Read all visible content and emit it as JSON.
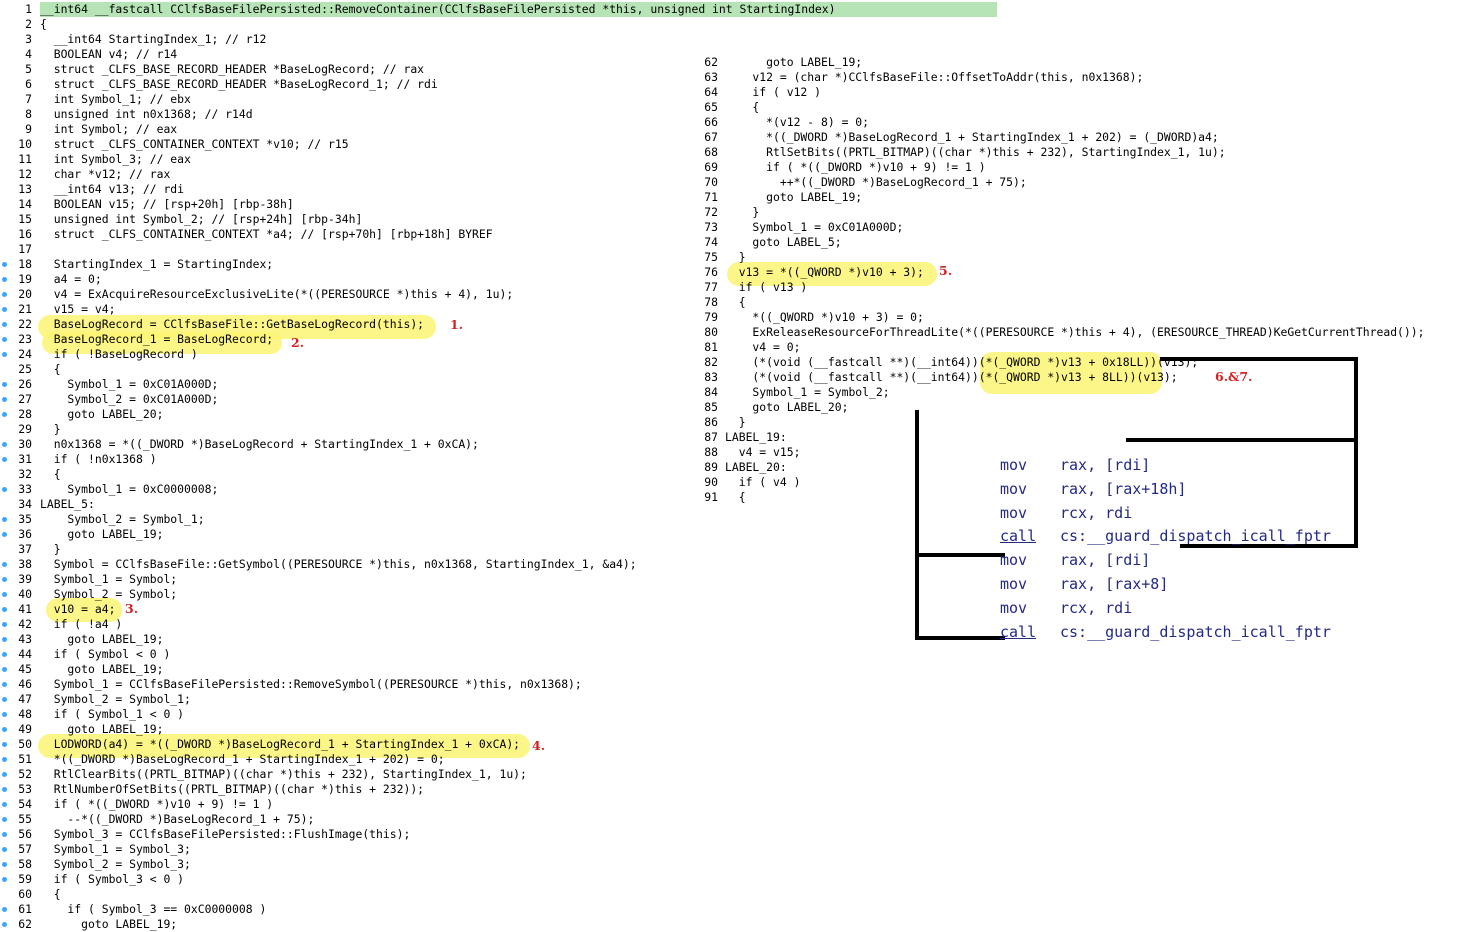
{
  "left_lines": [
    {
      "n": "1",
      "dot": false,
      "text": "__int64 __fastcall CClfsBaseFilePersisted::RemoveContainer(CClfsBaseFilePersisted *this, unsigned int StartingIndex)"
    },
    {
      "n": "2",
      "dot": false,
      "text": "{"
    },
    {
      "n": "3",
      "dot": false,
      "text": "  __int64 StartingIndex_1; // r12"
    },
    {
      "n": "4",
      "dot": false,
      "text": "  BOOLEAN v4; // r14"
    },
    {
      "n": "5",
      "dot": false,
      "text": "  struct _CLFS_BASE_RECORD_HEADER *BaseLogRecord; // rax"
    },
    {
      "n": "6",
      "dot": false,
      "text": "  struct _CLFS_BASE_RECORD_HEADER *BaseLogRecord_1; // rdi"
    },
    {
      "n": "7",
      "dot": false,
      "text": "  int Symbol_1; // ebx"
    },
    {
      "n": "8",
      "dot": false,
      "text": "  unsigned int n0x1368; // r14d"
    },
    {
      "n": "9",
      "dot": false,
      "text": "  int Symbol; // eax"
    },
    {
      "n": "10",
      "dot": false,
      "text": "  struct _CLFS_CONTAINER_CONTEXT *v10; // r15"
    },
    {
      "n": "11",
      "dot": false,
      "text": "  int Symbol_3; // eax"
    },
    {
      "n": "12",
      "dot": false,
      "text": "  char *v12; // rax"
    },
    {
      "n": "13",
      "dot": false,
      "text": "  __int64 v13; // rdi"
    },
    {
      "n": "14",
      "dot": false,
      "text": "  BOOLEAN v15; // [rsp+20h] [rbp-38h]"
    },
    {
      "n": "15",
      "dot": false,
      "text": "  unsigned int Symbol_2; // [rsp+24h] [rbp-34h]"
    },
    {
      "n": "16",
      "dot": false,
      "text": "  struct _CLFS_CONTAINER_CONTEXT *a4; // [rsp+70h] [rbp+18h] BYREF"
    },
    {
      "n": "17",
      "dot": false,
      "text": ""
    },
    {
      "n": "18",
      "dot": true,
      "text": "  StartingIndex_1 = StartingIndex;"
    },
    {
      "n": "19",
      "dot": true,
      "text": "  a4 = 0;"
    },
    {
      "n": "20",
      "dot": true,
      "text": "  v4 = ExAcquireResourceExclusiveLite(*((PERESOURCE *)this + 4), 1u);"
    },
    {
      "n": "21",
      "dot": true,
      "text": "  v15 = v4;"
    },
    {
      "n": "22",
      "dot": true,
      "text": "  BaseLogRecord = CClfsBaseFile::GetBaseLogRecord(this);"
    },
    {
      "n": "23",
      "dot": true,
      "text": "  BaseLogRecord_1 = BaseLogRecord;"
    },
    {
      "n": "24",
      "dot": true,
      "text": "  if ( !BaseLogRecord )"
    },
    {
      "n": "25",
      "dot": false,
      "text": "  {"
    },
    {
      "n": "26",
      "dot": true,
      "text": "    Symbol_1 = 0xC01A000D;"
    },
    {
      "n": "27",
      "dot": true,
      "text": "    Symbol_2 = 0xC01A000D;"
    },
    {
      "n": "28",
      "dot": true,
      "text": "    goto LABEL_20;"
    },
    {
      "n": "29",
      "dot": false,
      "text": "  }"
    },
    {
      "n": "30",
      "dot": true,
      "text": "  n0x1368 = *((_DWORD *)BaseLogRecord + StartingIndex_1 + 0xCA);"
    },
    {
      "n": "31",
      "dot": true,
      "text": "  if ( !n0x1368 )"
    },
    {
      "n": "32",
      "dot": false,
      "text": "  {"
    },
    {
      "n": "33",
      "dot": true,
      "text": "    Symbol_1 = 0xC0000008;"
    },
    {
      "n": "34",
      "dot": false,
      "text": "LABEL_5:"
    },
    {
      "n": "35",
      "dot": true,
      "text": "    Symbol_2 = Symbol_1;"
    },
    {
      "n": "36",
      "dot": true,
      "text": "    goto LABEL_19;"
    },
    {
      "n": "37",
      "dot": false,
      "text": "  }"
    },
    {
      "n": "38",
      "dot": true,
      "text": "  Symbol = CClfsBaseFile::GetSymbol((PERESOURCE *)this, n0x1368, StartingIndex_1, &a4);"
    },
    {
      "n": "39",
      "dot": true,
      "text": "  Symbol_1 = Symbol;"
    },
    {
      "n": "40",
      "dot": true,
      "text": "  Symbol_2 = Symbol;"
    },
    {
      "n": "41",
      "dot": true,
      "text": "  v10 = a4;"
    },
    {
      "n": "42",
      "dot": true,
      "text": "  if ( !a4 )"
    },
    {
      "n": "43",
      "dot": true,
      "text": "    goto LABEL_19;"
    },
    {
      "n": "44",
      "dot": true,
      "text": "  if ( Symbol < 0 )"
    },
    {
      "n": "45",
      "dot": true,
      "text": "    goto LABEL_19;"
    },
    {
      "n": "46",
      "dot": true,
      "text": "  Symbol_1 = CClfsBaseFilePersisted::RemoveSymbol((PERESOURCE *)this, n0x1368);"
    },
    {
      "n": "47",
      "dot": true,
      "text": "  Symbol_2 = Symbol_1;"
    },
    {
      "n": "48",
      "dot": true,
      "text": "  if ( Symbol_1 < 0 )"
    },
    {
      "n": "49",
      "dot": true,
      "text": "    goto LABEL_19;"
    },
    {
      "n": "50",
      "dot": true,
      "text": "  LODWORD(a4) = *((_DWORD *)BaseLogRecord_1 + StartingIndex_1 + 0xCA);"
    },
    {
      "n": "51",
      "dot": true,
      "text": "  *((_DWORD *)BaseLogRecord_1 + StartingIndex_1 + 202) = 0;"
    },
    {
      "n": "52",
      "dot": true,
      "text": "  RtlClearBits((PRTL_BITMAP)((char *)this + 232), StartingIndex_1, 1u);"
    },
    {
      "n": "53",
      "dot": true,
      "text": "  RtlNumberOfSetBits((PRTL_BITMAP)((char *)this + 232));"
    },
    {
      "n": "54",
      "dot": true,
      "text": "  if ( *((_DWORD *)v10 + 9) != 1 )"
    },
    {
      "n": "55",
      "dot": true,
      "text": "    --*((_DWORD *)BaseLogRecord_1 + 75);"
    },
    {
      "n": "56",
      "dot": true,
      "text": "  Symbol_3 = CClfsBaseFilePersisted::FlushImage(this);"
    },
    {
      "n": "57",
      "dot": true,
      "text": "  Symbol_1 = Symbol_3;"
    },
    {
      "n": "58",
      "dot": true,
      "text": "  Symbol_2 = Symbol_3;"
    },
    {
      "n": "59",
      "dot": true,
      "text": "  if ( Symbol_3 < 0 )"
    },
    {
      "n": "60",
      "dot": false,
      "text": "  {"
    },
    {
      "n": "61",
      "dot": true,
      "text": "    if ( Symbol_3 == 0xC0000008 )"
    },
    {
      "n": "62",
      "dot": true,
      "text": "      goto LABEL_19;"
    }
  ],
  "right_lines": [
    {
      "n": "62",
      "text": "      goto LABEL_19;"
    },
    {
      "n": "63",
      "text": "    v12 = (char *)CClfsBaseFile::OffsetToAddr(this, n0x1368);"
    },
    {
      "n": "64",
      "text": "    if ( v12 )"
    },
    {
      "n": "65",
      "text": "    {"
    },
    {
      "n": "66",
      "text": "      *(v12 - 8) = 0;"
    },
    {
      "n": "67",
      "text": "      *((_DWORD *)BaseLogRecord_1 + StartingIndex_1 + 202) = (_DWORD)a4;"
    },
    {
      "n": "68",
      "text": "      RtlSetBits((PRTL_BITMAP)((char *)this + 232), StartingIndex_1, 1u);"
    },
    {
      "n": "69",
      "text": "      if ( *((_DWORD *)v10 + 9) != 1 )"
    },
    {
      "n": "70",
      "text": "        ++*((_DWORD *)BaseLogRecord_1 + 75);"
    },
    {
      "n": "71",
      "text": "      goto LABEL_19;"
    },
    {
      "n": "72",
      "text": "    }"
    },
    {
      "n": "73",
      "text": "    Symbol_1 = 0xC01A000D;"
    },
    {
      "n": "74",
      "text": "    goto LABEL_5;"
    },
    {
      "n": "75",
      "text": "  }"
    },
    {
      "n": "76",
      "text": "  v13 = *((_QWORD *)v10 + 3);"
    },
    {
      "n": "77",
      "text": "  if ( v13 )"
    },
    {
      "n": "78",
      "text": "  {"
    },
    {
      "n": "79",
      "text": "    *((_QWORD *)v10 + 3) = 0;"
    },
    {
      "n": "80",
      "text": "    ExReleaseResourceForThreadLite(*((PERESOURCE *)this + 4), (ERESOURCE_THREAD)KeGetCurrentThread());"
    },
    {
      "n": "81",
      "text": "    v4 = 0;"
    },
    {
      "n": "82",
      "text": "    (*(void (__fastcall **)(__int64))(*(_QWORD *)v13 + 0x18LL))(v13);"
    },
    {
      "n": "83",
      "text": "    (*(void (__fastcall **)(__int64))(*(_QWORD *)v13 + 8LL))(v13);"
    },
    {
      "n": "84",
      "text": "    Symbol_1 = Symbol_2;"
    },
    {
      "n": "85",
      "text": "    goto LABEL_20;"
    },
    {
      "n": "86",
      "text": "  }"
    },
    {
      "n": "87",
      "text": "LABEL_19:"
    },
    {
      "n": "88",
      "text": "  v4 = v15;"
    },
    {
      "n": "89",
      "text": "LABEL_20:"
    },
    {
      "n": "90",
      "text": "  if ( v4 )"
    },
    {
      "n": "91",
      "text": "  {"
    }
  ],
  "markers": {
    "m1": "1.",
    "m2": "2.",
    "m3": "3.",
    "m4": "4.",
    "m5": "5.",
    "m67": "6.&7."
  },
  "asm": [
    {
      "op": "mov",
      "args": "rax, [rdi]"
    },
    {
      "op": "mov",
      "args": "rax, [rax+18h]"
    },
    {
      "op": "mov",
      "args": "rcx, rdi"
    },
    {
      "op": "call",
      "args": "cs:__guard_dispatch_icall_fptr"
    },
    {
      "op": "mov",
      "args": "rax, [rdi]"
    },
    {
      "op": "mov",
      "args": "rax, [rax+8]"
    },
    {
      "op": "mov",
      "args": "rcx, rdi"
    },
    {
      "op": "call",
      "args": "cs:__guard_dispatch_icall_fptr"
    }
  ],
  "colors": {
    "highlight": "#fbf473",
    "marker_red": "#d22222",
    "header_green": "#b7e4b6",
    "breakpoint_dot": "#3ea5ff",
    "asm_text": "#232a85"
  }
}
